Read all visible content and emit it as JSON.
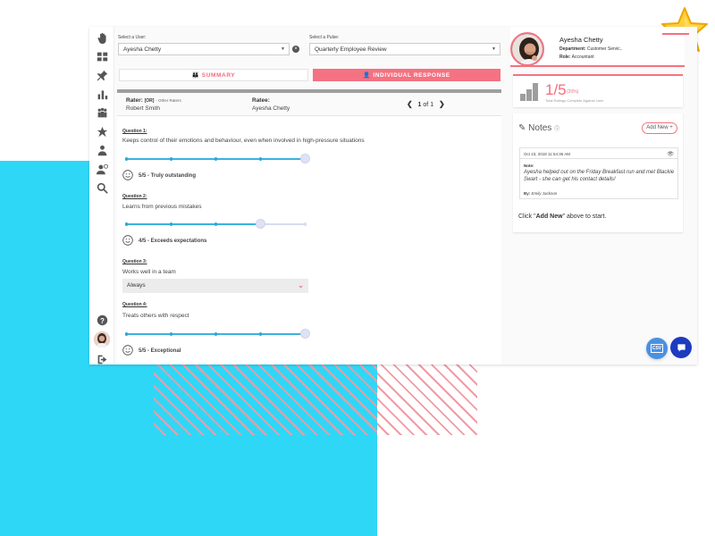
{
  "colors": {
    "accent": "#f47281",
    "cyan": "#2fd7f7",
    "slider": "#3ab2e0",
    "blue": "#4a90e2"
  },
  "filters": {
    "user_label": "Select a User:",
    "user_value": "Ayesha Chetty",
    "pulse_label": "Select a Pulse:",
    "pulse_value": "Quarterly Employee Review"
  },
  "tabs": {
    "summary": "SUMMARY",
    "individual": "INDIVIDUAL RESPONSE"
  },
  "raters": {
    "rater_label": "Rater:",
    "rater_or": "[OR]",
    "rater_other": "- Other Raters",
    "rater_value": "Robert Smith",
    "ratee_label": "Ratee:",
    "ratee_value": "Ayesha Chetty",
    "page_current": "1",
    "page_of": "of",
    "page_total": "1"
  },
  "questions": [
    {
      "title": "Question 1:",
      "text": "Keeps control of their emotions and behaviour, even when involved in high-pressure situations",
      "score": 5,
      "max": 5,
      "rating": "5/5 - Truly outstanding"
    },
    {
      "title": "Question 2:",
      "text": "Learns from previous mistakes",
      "score": 4,
      "max": 5,
      "rating": "4/5 - Exceeds expectations"
    },
    {
      "title": "Question 3:",
      "text": "Works well in a team",
      "answer": "Always"
    },
    {
      "title": "Question 4:",
      "text": "Treats others with respect",
      "score": 5,
      "max": 5,
      "rating": "5/5 - Exceptional"
    }
  ],
  "profile": {
    "name": "Ayesha Chetty",
    "department_label": "Department:",
    "department_value": "Customer Servic..",
    "role_label": "Role:",
    "role_value": "Accountant"
  },
  "stats": {
    "fraction": "1/5",
    "percent": "(20%)",
    "caption": "Total Ratings Complete Against User"
  },
  "notes": {
    "title": "Notes",
    "add_new": "Add New +",
    "date": "Oct 23, 2018 11:54:36 AM",
    "note_label": "Note:",
    "note_text": "Ayesha helped out on the Friday Breakfast run and met Blackie Swart - she can get his contact details!",
    "by_label": "By:",
    "by_value": "Emily Jackson",
    "hint_pre": "Click \"",
    "hint_bold": "Add New",
    "hint_post": "\" above to start."
  },
  "csv_label": "CSV"
}
